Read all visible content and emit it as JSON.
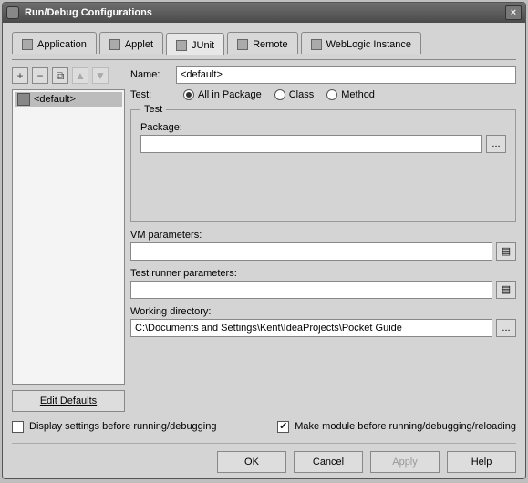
{
  "window": {
    "title": "Run/Debug Configurations"
  },
  "tabs": [
    {
      "label": "Application"
    },
    {
      "label": "Applet"
    },
    {
      "label": "JUnit"
    },
    {
      "label": "Remote"
    },
    {
      "label": "WebLogic Instance"
    }
  ],
  "active_tab": 2,
  "toolbar": {
    "add": "+",
    "remove": "−",
    "copy": "⧉",
    "up": "▲",
    "down": "▼"
  },
  "sidebar": {
    "items": [
      {
        "label": "<default>"
      }
    ],
    "edit_defaults": "Edit Defaults"
  },
  "form": {
    "name_label": "Name:",
    "name_value": "<default>",
    "test_label": "Test:",
    "radios": {
      "all_in_package": "All in Package",
      "class": "Class",
      "method": "Method"
    },
    "selected_radio": "all_in_package",
    "fieldset_legend": "Test",
    "package_label": "Package:",
    "package_value": "",
    "vm_label": "VM parameters:",
    "vm_value": "",
    "runner_label": "Test runner parameters:",
    "runner_value": "",
    "workdir_label": "Working directory:",
    "workdir_value": "C:\\Documents and Settings\\Kent\\IdeaProjects\\Pocket Guide",
    "browse": "..."
  },
  "checks": {
    "display_before": "Display settings before running/debugging",
    "display_before_checked": false,
    "make_module": "Make module before running/debugging/reloading",
    "make_module_checked": true
  },
  "buttons": {
    "ok": "OK",
    "cancel": "Cancel",
    "apply": "Apply",
    "help": "Help"
  }
}
